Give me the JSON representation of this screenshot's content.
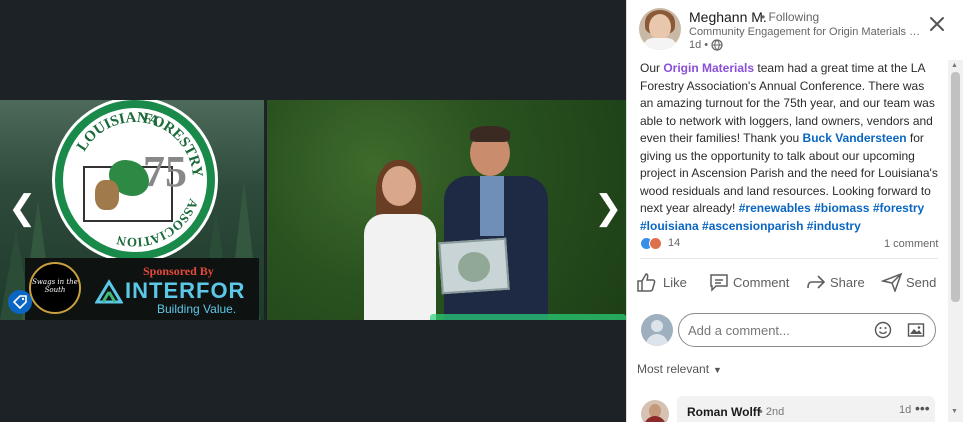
{
  "media": {
    "logo": {
      "ring_text_top": "FORESTRY",
      "ring_text_left": "LOUISIANA",
      "ring_text_bottom": "ASSOCIATION",
      "number": "75"
    },
    "sponsor": {
      "badge_text": "Swags in the South",
      "sponsored_by": "Sponsored By",
      "brand": "INTERFOR",
      "tagline": "Building Value."
    },
    "prev_arrow": "❮",
    "next_arrow": "❯"
  },
  "post": {
    "author": {
      "name": "Meghann M.",
      "follow_status": "• Following",
      "headline": "Community Engagement for Origin Materials in A...",
      "time": "1d •"
    },
    "body": {
      "part1": "Our ",
      "mention_org": "Origin Materials",
      "part2": " team had a great time at the LA Forestry Association's Annual Conference. There was an amazing turnout for the 75th year, and our team was able to network with loggers, land owners, vendors and even their families! Thank you ",
      "mention_person": "Buck Vandersteen",
      "part3": " for giving us the opportunity to talk about our upcoming project in Ascension Parish and the need for Louisiana's wood residuals and land resources. Looking forward to next year already! ",
      "hashtags": [
        "#renewables",
        "#biomass",
        "#forestry",
        "#louisiana",
        "#ascensionparish",
        "#industry"
      ]
    },
    "reaction_count": "14",
    "comment_count": "1 comment",
    "actions": {
      "like": "Like",
      "comment": "Comment",
      "share": "Share",
      "send": "Send"
    },
    "comment_input": {
      "placeholder": "Add a comment..."
    },
    "sort_label": "Most relevant",
    "comments": [
      {
        "name": "Roman Wolff",
        "degree": "• 2nd",
        "time": "1d",
        "more": "•••"
      }
    ]
  },
  "colors": {
    "accent": "#0a66c2",
    "mention_org": "#8a4fd8",
    "page_bg": "#1d2226",
    "panel_bg": "#ffffff"
  }
}
